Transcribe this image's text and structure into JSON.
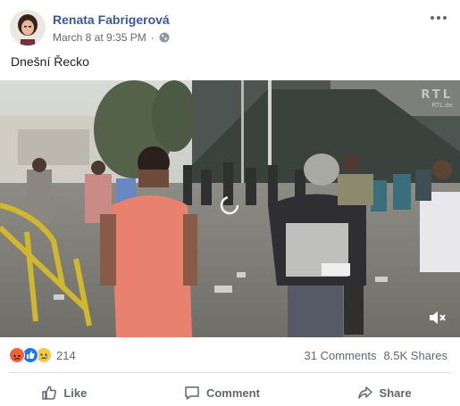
{
  "post": {
    "author": "Renata Fabrigerová",
    "timestamp": "March 8 at 9:35 PM",
    "audience_icon": "globe-icon",
    "text": "Dnešní Řecko"
  },
  "video": {
    "watermark_logo": "RTL",
    "watermark_url": "RTL.de",
    "mute_icon": "speaker-muted-icon"
  },
  "stats": {
    "reactions": [
      "angry",
      "like",
      "sad"
    ],
    "reaction_count": "214",
    "comments": "31 Comments",
    "shares": "8.5K Shares"
  },
  "actions": {
    "like_label": "Like",
    "comment_label": "Comment",
    "share_label": "Share"
  },
  "colors": {
    "author_link": "#385898",
    "meta_gray": "#616770",
    "like_blue": "#1877f2",
    "angry_orange": "#f0623a",
    "sad_yellow": "#f7c844"
  }
}
